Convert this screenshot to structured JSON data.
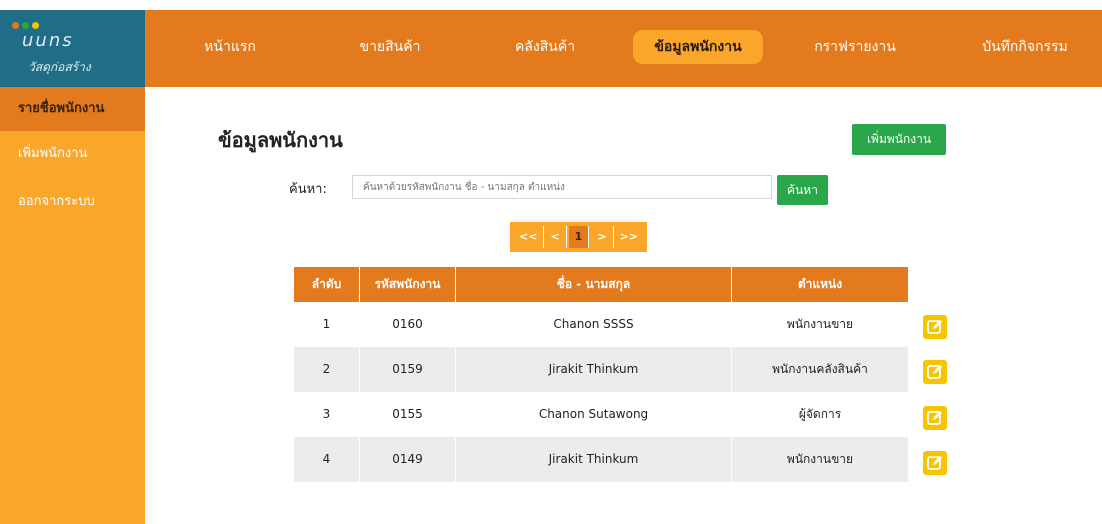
{
  "logo": {
    "title": "uuns",
    "subtitle": "วัสดุก่อสร้าง",
    "dot_colors": [
      "#e37a1e",
      "#2aa74a",
      "#f6c400"
    ]
  },
  "nav": {
    "items": [
      {
        "label": "หน้าแรก"
      },
      {
        "label": "ขายสินค้า"
      },
      {
        "label": "คลังสินค้า"
      },
      {
        "label": "ข้อมูลพนักงาน"
      },
      {
        "label": "กราฟรายงาน"
      },
      {
        "label": "บันทึกกิจกรรม"
      }
    ],
    "active_index": 3
  },
  "sidebar": {
    "items": [
      {
        "label": "รายชื่อพนักงาน"
      },
      {
        "label": "เพิ่มพนักงาน"
      },
      {
        "label": "ออกจากระบบ"
      }
    ]
  },
  "main": {
    "title": "ข้อมูลพนักงาน",
    "add_button": "เพิ่มพนักงาน",
    "search_label": "ค้นหา:",
    "search_placeholder": "ค้นหาด้วยรหัสพนักงาน ชื่อ - นามสกุล ตำแหน่ง",
    "search_button": "ค้นหา"
  },
  "pagination": {
    "first": "<<",
    "prev": "<",
    "current": "1",
    "next": ">",
    "last": ">>"
  },
  "table": {
    "headers": [
      "ลำดับ",
      "รหัสพนักงาน",
      "ชื่อ - นามสกุล",
      "ตำแหน่ง"
    ],
    "rows": [
      {
        "no": "1",
        "id": "0160",
        "name": "Chanon SSSS",
        "position": "พนักงานขาย"
      },
      {
        "no": "2",
        "id": "0159",
        "name": "Jirakit Thinkum",
        "position": "พนักงานคลังสินค้า"
      },
      {
        "no": "3",
        "id": "0155",
        "name": "Chanon Sutawong",
        "position": "ผู้จัดการ"
      },
      {
        "no": "4",
        "id": "0149",
        "name": "Jirakit Thinkum",
        "position": "พนักงานขาย"
      }
    ]
  },
  "colors": {
    "primary_orange": "#e37a1e",
    "light_orange": "#f9a62b",
    "green": "#2aa74a",
    "logo_bg": "#1f6d86",
    "edit_yellow": "#f6c400"
  },
  "icons": {
    "edit": "edit-icon"
  }
}
